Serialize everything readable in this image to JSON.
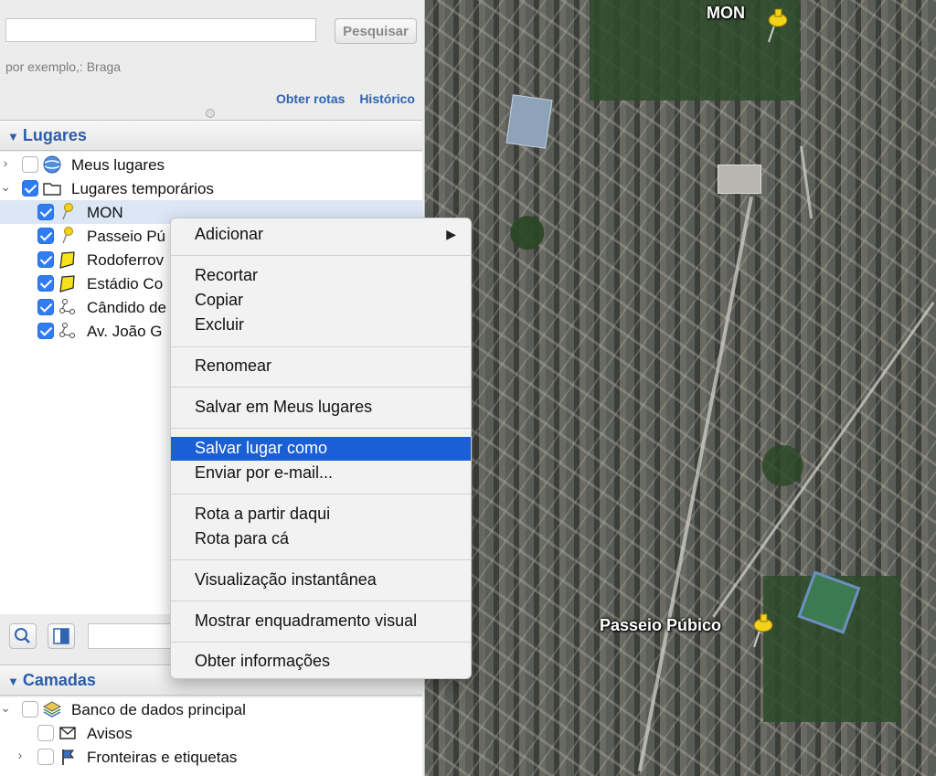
{
  "search": {
    "placeholder": "",
    "button": "Pesquisar",
    "example": "por exemplo,: Braga",
    "link_routes": "Obter rotas",
    "link_history": "Histórico"
  },
  "places": {
    "header": "Lugares",
    "items": [
      {
        "label": "Meus lugares"
      },
      {
        "label": "Lugares temporários"
      },
      {
        "label": "MON"
      },
      {
        "label": "Passeio Pú"
      },
      {
        "label": "Rodoferrov"
      },
      {
        "label": "Estádio Co"
      },
      {
        "label": "Cândido de"
      },
      {
        "label": "Av. João G"
      }
    ]
  },
  "layers": {
    "header": "Camadas",
    "items": [
      {
        "label": "Banco de dados principal"
      },
      {
        "label": "Avisos"
      },
      {
        "label": "Fronteiras e etiquetas"
      }
    ]
  },
  "context_menu": {
    "items": [
      {
        "label": "Adicionar",
        "submenu": "▶"
      },
      {
        "label": "Recortar"
      },
      {
        "label": "Copiar"
      },
      {
        "label": "Excluir"
      },
      {
        "label": "Renomear"
      },
      {
        "label": "Salvar em Meus lugares"
      },
      {
        "label": "Salvar lugar como"
      },
      {
        "label": "Enviar por e-mail..."
      },
      {
        "label": "Rota a partir daqui"
      },
      {
        "label": "Rota para cá"
      },
      {
        "label": "Visualização instantânea"
      },
      {
        "label": "Mostrar enquadramento visual"
      },
      {
        "label": "Obter informações"
      }
    ],
    "highlighted": "Salvar lugar como"
  },
  "map": {
    "label_mon": "MON",
    "label_passeio": "Passeio Púbico"
  },
  "colors": {
    "accent": "#1b5fd6",
    "header_text": "#2c5da8",
    "checkbox": "#2f7df6",
    "pin": "#f2d21c"
  }
}
